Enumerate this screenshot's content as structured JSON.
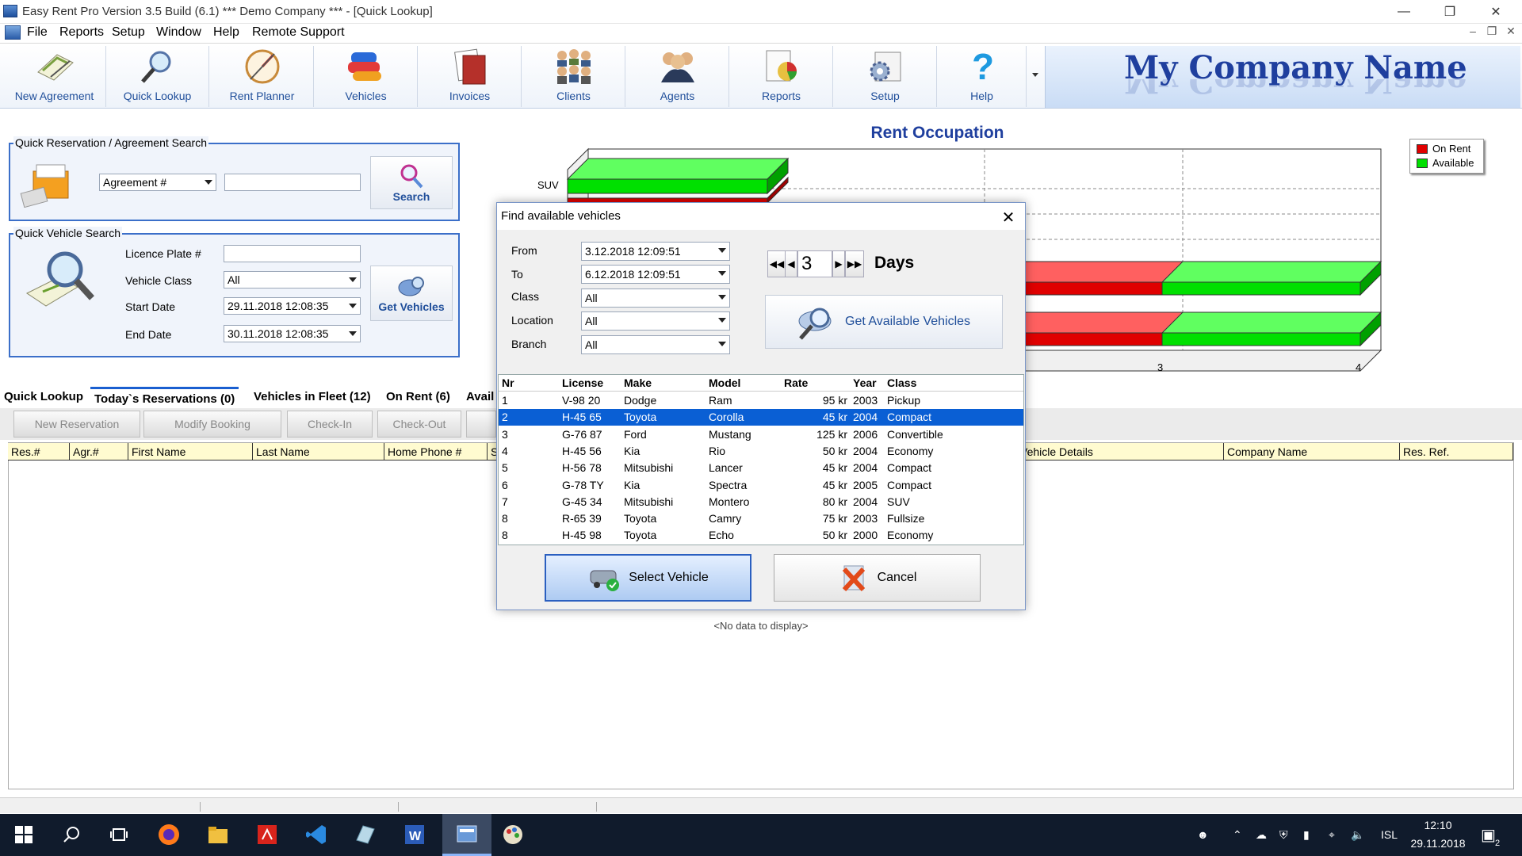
{
  "window": {
    "title": "Easy Rent Pro  Version 3.5 Build (6.1)  *** Demo Company *** - [Quick Lookup]"
  },
  "menu": [
    "File",
    "Reports",
    "Setup",
    "Window",
    "Help",
    "Remote Support"
  ],
  "toolbar": [
    "New Agreement",
    "Quick Lookup",
    "Rent Planner",
    "Vehicles",
    "Invoices",
    "Clients",
    "Agents",
    "Reports",
    "Setup",
    "Help"
  ],
  "company_name": "My Company Name",
  "quick_res": {
    "legend": "Quick Reservation / Agreement Search",
    "type_value": "Agreement #",
    "search_value": "",
    "search_label": "Search"
  },
  "vehicle_search": {
    "legend": "Quick  Vehicle Search",
    "plate_label": "Licence Plate #",
    "plate_value": "",
    "class_label": "Vehicle Class",
    "class_value": "All",
    "start_label": "Start Date",
    "start_value": "29.11.2018 12:08:35",
    "end_label": "End Date",
    "end_value": "30.11.2018 12:08:35",
    "get_label": "Get Vehicles"
  },
  "occupation": {
    "title": "Rent Occupation",
    "visible_category": "SUV",
    "axis_ticks": [
      "3",
      "4"
    ],
    "legend": [
      {
        "name": "On Rent",
        "color": "#e00000"
      },
      {
        "name": "Available",
        "color": "#00e000"
      }
    ]
  },
  "tabs": [
    "Quick Lookup",
    "Today`s Reservations (0)",
    "Vehicles in Fleet (12)",
    "On Rent (6)",
    "Avail"
  ],
  "commands": [
    "New Reservation",
    "Modify Booking",
    "Check-In",
    "Check-Out"
  ],
  "grid": {
    "columns": [
      "Res.#",
      "Agr.#",
      "First Name",
      "Last Name",
      "Home Phone #",
      "S",
      "Vehicle Details",
      "Company Name",
      "Res. Ref."
    ],
    "empty_text": "<No data to display>"
  },
  "dialog": {
    "title": "Find available vehicles",
    "from_label": "From",
    "from_value": "3.12.2018 12:09:51",
    "to_label": "To",
    "to_value": "6.12.2018 12:09:51",
    "class_label": "Class",
    "class_value": "All",
    "location_label": "Location",
    "location_value": "All",
    "branch_label": "Branch",
    "branch_value": "All",
    "days_value": "3",
    "days_label": "Days",
    "get_available_label": "Get Available Vehicles",
    "columns": [
      "Nr",
      "License",
      "Make",
      "Model",
      "Rate",
      "Year",
      "Class"
    ],
    "rows": [
      [
        "1",
        "V-98 20",
        "Dodge",
        "Ram",
        "95 kr",
        "2003",
        "Pickup"
      ],
      [
        "2",
        "H-45 65",
        "Toyota",
        "Corolla",
        "45 kr",
        "2004",
        "Compact"
      ],
      [
        "3",
        "G-76 87",
        "Ford",
        "Mustang",
        "125 kr",
        "2006",
        "Convertible"
      ],
      [
        "4",
        "H-45 56",
        "Kia",
        "Rio",
        "50 kr",
        "2004",
        "Economy"
      ],
      [
        "5",
        "H-56 78",
        "Mitsubishi",
        "Lancer",
        "45 kr",
        "2004",
        "Compact"
      ],
      [
        "6",
        "G-78 TY",
        "Kia",
        "Spectra",
        "45 kr",
        "2005",
        "Compact"
      ],
      [
        "7",
        "G-45 34",
        "Mitsubishi",
        "Montero",
        "80 kr",
        "2004",
        "SUV"
      ],
      [
        "8",
        "R-65 39",
        "Toyota",
        "Camry",
        "75 kr",
        "2003",
        "Fullsize"
      ],
      [
        "8",
        "H-45 98",
        "Toyota",
        "Echo",
        "50 kr",
        "2000",
        "Economy"
      ]
    ],
    "selected_row": 1,
    "select_label": "Select Vehicle",
    "cancel_label": "Cancel"
  },
  "taskbar": {
    "lang": "ISL",
    "time": "12:10",
    "date": "29.11.2018",
    "notifications": "2"
  }
}
